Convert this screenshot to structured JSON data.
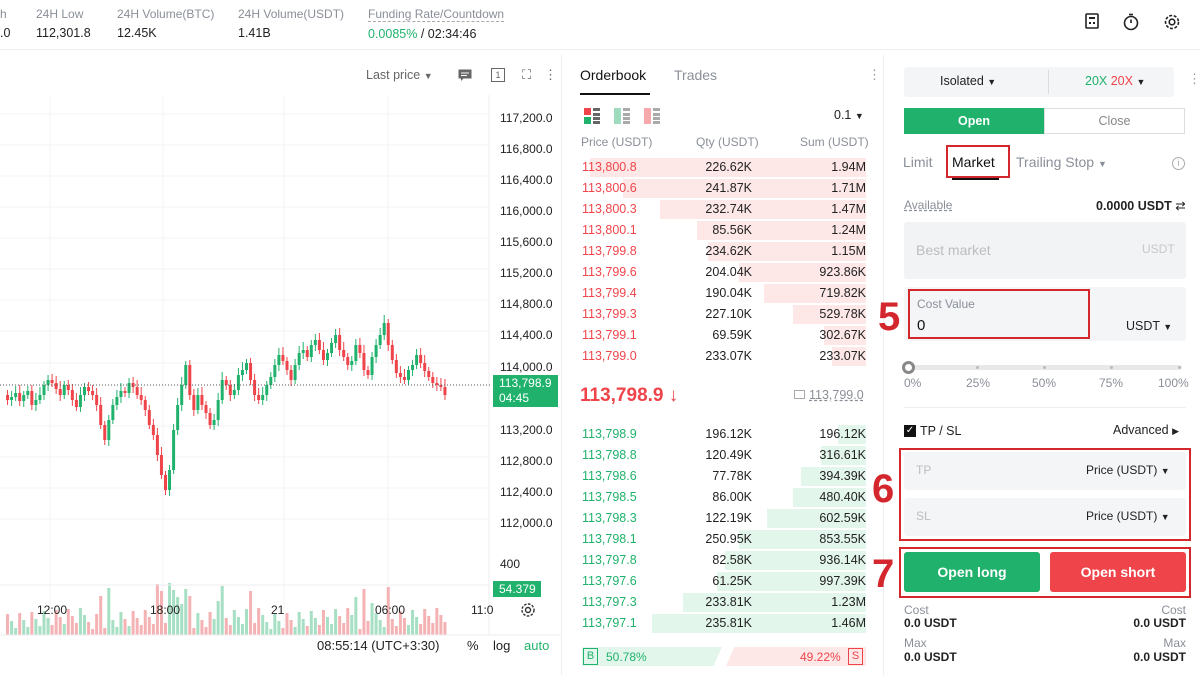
{
  "topbar": {
    "stats": [
      {
        "label": "h",
        "value": ".0"
      },
      {
        "label": "24H Low",
        "value": "112,301.8"
      },
      {
        "label": "24H Volume(BTC)",
        "value": "12.45K"
      },
      {
        "label": "24H Volume(USDT)",
        "value": "1.41B"
      }
    ],
    "funding_label": "Funding Rate/Countdown",
    "funding_rate": "0.0085%",
    "countdown": "/ 02:34:46"
  },
  "chart": {
    "price_type": "Last price",
    "y_ticks": [
      "117,200.0",
      "116,800.0",
      "116,400.0",
      "116,000.0",
      "115,600.0",
      "115,200.0",
      "114,800.0",
      "114,400.0",
      "114,000.0",
      "113,200.0",
      "112,800.0",
      "112,400.0",
      "112,000.0"
    ],
    "current_price": "113,798.9",
    "current_timer": "04:45",
    "volume_tick": "400",
    "volume_value": "54.379",
    "x_ticks": [
      "12:00",
      "18:00",
      "21",
      "06:00",
      "11:0"
    ],
    "clock": "08:55:14 (UTC+3:30)",
    "percent_label": "%",
    "log_label": "log",
    "auto_label": "auto",
    "colors": {
      "up": "#20b26c",
      "down": "#ef454a"
    }
  },
  "orderbook": {
    "tab_orderbook": "Orderbook",
    "tab_trades": "Trades",
    "precision": "0.1",
    "col_price": "Price (USDT)",
    "col_qty": "Qty (USDT)",
    "col_sum": "Sum (USDT)",
    "asks": [
      {
        "price": "113,800.8",
        "qty": "226.62K",
        "sum": "1.94M",
        "depth": 0.98
      },
      {
        "price": "113,800.6",
        "qty": "241.87K",
        "sum": "1.71M",
        "depth": 0.86
      },
      {
        "price": "113,800.3",
        "qty": "232.74K",
        "sum": "1.47M",
        "depth": 0.73
      },
      {
        "price": "113,800.1",
        "qty": "85.56K",
        "sum": "1.24M",
        "depth": 0.6
      },
      {
        "price": "113,799.8",
        "qty": "234.62K",
        "sum": "1.15M",
        "depth": 0.56
      },
      {
        "price": "113,799.6",
        "qty": "204.04K",
        "sum": "923.86K",
        "depth": 0.45
      },
      {
        "price": "113,799.4",
        "qty": "190.04K",
        "sum": "719.82K",
        "depth": 0.36
      },
      {
        "price": "113,799.3",
        "qty": "227.10K",
        "sum": "529.78K",
        "depth": 0.26
      },
      {
        "price": "113,799.1",
        "qty": "69.59K",
        "sum": "302.67K",
        "depth": 0.15
      },
      {
        "price": "113,799.0",
        "qty": "233.07K",
        "sum": "233.07K",
        "depth": 0.12
      }
    ],
    "last_price": "113,798.9",
    "last_arrow": "↓",
    "mark_price": "113,799.0",
    "bids": [
      {
        "price": "113,798.9",
        "qty": "196.12K",
        "sum": "196.12K",
        "depth": 0.1
      },
      {
        "price": "113,798.8",
        "qty": "120.49K",
        "sum": "316.61K",
        "depth": 0.16
      },
      {
        "price": "113,798.6",
        "qty": "77.78K",
        "sum": "394.39K",
        "depth": 0.23
      },
      {
        "price": "113,798.5",
        "qty": "86.00K",
        "sum": "480.40K",
        "depth": 0.26
      },
      {
        "price": "113,798.3",
        "qty": "122.19K",
        "sum": "602.59K",
        "depth": 0.35
      },
      {
        "price": "113,798.1",
        "qty": "250.95K",
        "sum": "853.55K",
        "depth": 0.45
      },
      {
        "price": "113,797.8",
        "qty": "82.58K",
        "sum": "936.14K",
        "depth": 0.5
      },
      {
        "price": "113,797.6",
        "qty": "61.25K",
        "sum": "997.39K",
        "depth": 0.53
      },
      {
        "price": "113,797.3",
        "qty": "233.81K",
        "sum": "1.23M",
        "depth": 0.65
      },
      {
        "price": "113,797.1",
        "qty": "235.81K",
        "sum": "1.46M",
        "depth": 0.76
      }
    ],
    "buy_tag": "B",
    "buy_pct": "50.78%",
    "sell_pct": "49.22%",
    "sell_tag": "S"
  },
  "form": {
    "margin_mode": "Isolated",
    "lev_long": "20X",
    "lev_short": "20X",
    "tab_open": "Open",
    "tab_close": "Close",
    "type_limit": "Limit",
    "type_market": "Market",
    "type_trailing": "Trailing Stop",
    "available_label": "Available",
    "available_value": "0.0000 USDT",
    "best_market_placeholder": "Best market",
    "best_market_unit": "USDT",
    "cost_value_label": "Cost Value",
    "cost_value": "0",
    "cost_unit": "USDT",
    "slider_labels": [
      "0%",
      "25%",
      "50%",
      "75%",
      "100%"
    ],
    "slider_level": 0,
    "tpsl_label": "TP / SL",
    "advanced_label": "Advanced",
    "tp_placeholder": "TP",
    "tp_unit": "Price (USDT)",
    "sl_placeholder": "SL",
    "sl_unit": "Price (USDT)",
    "open_long": "Open long",
    "open_short": "Open short",
    "cost_left_label": "Cost",
    "cost_left_value": "0.0 USDT",
    "cost_right_label": "Cost",
    "cost_right_value": "0.0 USDT",
    "max_left_label": "Max",
    "max_left_value": "0.0 USDT",
    "max_right_label": "Max",
    "max_right_value": "0.0 USDT",
    "annotation_5": "5",
    "annotation_6": "6",
    "annotation_7": "7"
  }
}
